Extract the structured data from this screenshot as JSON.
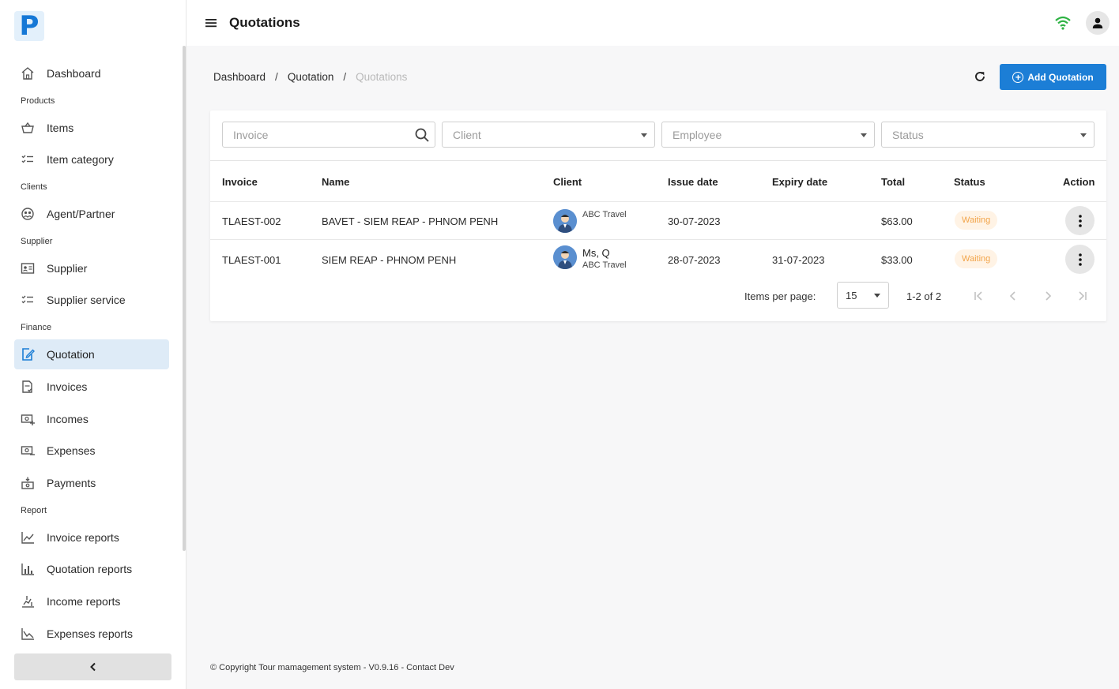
{
  "app": {
    "logo_letter": "P",
    "page_title": "Quotations"
  },
  "sidebar": {
    "items": [
      {
        "type": "item",
        "label": "Dashboard",
        "icon": "home-icon",
        "active": false
      },
      {
        "type": "section",
        "label": "Products"
      },
      {
        "type": "item",
        "label": "Items",
        "icon": "basket-icon",
        "active": false
      },
      {
        "type": "item",
        "label": "Item category",
        "icon": "checklist-icon",
        "active": false
      },
      {
        "type": "section",
        "label": "Clients"
      },
      {
        "type": "item",
        "label": "Agent/Partner",
        "icon": "partner-icon",
        "active": false
      },
      {
        "type": "section",
        "label": "Supplier"
      },
      {
        "type": "item",
        "label": "Supplier",
        "icon": "id-card-icon",
        "active": false
      },
      {
        "type": "item",
        "label": "Supplier service",
        "icon": "checklist-icon",
        "active": false
      },
      {
        "type": "section",
        "label": "Finance"
      },
      {
        "type": "item",
        "label": "Quotation",
        "icon": "edit-document-icon",
        "active": true
      },
      {
        "type": "item",
        "label": "Invoices",
        "icon": "invoice-icon",
        "active": false
      },
      {
        "type": "item",
        "label": "Incomes",
        "icon": "income-icon",
        "active": false
      },
      {
        "type": "item",
        "label": "Expenses",
        "icon": "expense-icon",
        "active": false
      },
      {
        "type": "item",
        "label": "Payments",
        "icon": "payment-icon",
        "active": false
      },
      {
        "type": "section",
        "label": "Report"
      },
      {
        "type": "item",
        "label": "Invoice reports",
        "icon": "line-chart-icon",
        "active": false
      },
      {
        "type": "item",
        "label": "Quotation reports",
        "icon": "bar-chart-icon",
        "active": false
      },
      {
        "type": "item",
        "label": "Income reports",
        "icon": "income-chart-icon",
        "active": false
      },
      {
        "type": "item",
        "label": "Expenses reports",
        "icon": "expense-chart-icon",
        "active": false
      }
    ]
  },
  "breadcrumb": {
    "items": [
      "Dashboard",
      "Quotation"
    ],
    "current": "Quotations"
  },
  "toolbar": {
    "add_label": "Add Quotation"
  },
  "filters": {
    "invoice_placeholder": "Invoice",
    "client_placeholder": "Client",
    "employee_placeholder": "Employee",
    "status_placeholder": "Status"
  },
  "table": {
    "headers": {
      "invoice": "Invoice",
      "name": "Name",
      "client": "Client",
      "issue_date": "Issue date",
      "expiry_date": "Expiry date",
      "total": "Total",
      "status": "Status",
      "action": "Action"
    },
    "rows": [
      {
        "invoice": "TLAEST-002",
        "name": "BAVET - SIEM REAP - PHNOM PENH",
        "client_name": "",
        "client_company": "ABC Travel",
        "issue_date": "30-07-2023",
        "expiry_date": "",
        "total": "$63.00",
        "status": "Waiting"
      },
      {
        "invoice": "TLAEST-001",
        "name": "SIEM REAP - PHNOM PENH",
        "client_name": "Ms, Q",
        "client_company": "ABC Travel",
        "issue_date": "28-07-2023",
        "expiry_date": "31-07-2023",
        "total": "$33.00",
        "status": "Waiting"
      }
    ]
  },
  "pagination": {
    "label": "Items per page:",
    "page_size": "15",
    "range": "1-2 of 2"
  },
  "footer": {
    "text": "© Copyright Tour mamagement system - V0.9.16 - Contact Dev"
  },
  "colors": {
    "primary": "#1c7ed6",
    "active_bg": "#deebf7",
    "badge_text": "#f2a44a",
    "wifi": "#2fb344"
  }
}
